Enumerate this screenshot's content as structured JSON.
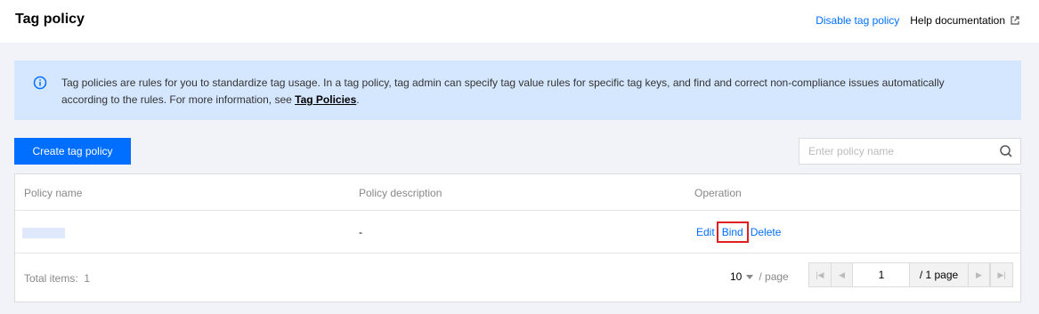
{
  "header": {
    "title": "Tag policy",
    "disable_link": "Disable tag policy",
    "help_link": "Help documentation"
  },
  "notice": {
    "text": "Tag policies are rules for you to standardize tag usage. In a tag policy, tag admin can specify tag value rules for specific tag keys, and find and correct non-compliance issues automatically according to the rules. For more information, see ",
    "link": "Tag Policies",
    "suffix": "."
  },
  "toolbar": {
    "create_label": "Create tag policy",
    "search_placeholder": "Enter policy name"
  },
  "table": {
    "columns": [
      "Policy name",
      "Policy description",
      "Operation"
    ],
    "rows": [
      {
        "name": "",
        "description": "-",
        "operations": [
          "Edit",
          "Bind",
          "Delete"
        ]
      }
    ]
  },
  "pagination": {
    "total_label": "Total items:",
    "total": "1",
    "page_size": "10",
    "per_page_label": "/ page",
    "current_page": "1",
    "total_pages_label": "/ 1 page"
  },
  "colors": {
    "accent": "#006eff",
    "notice_bg": "#d5e7ff",
    "highlight": "#e02020"
  }
}
